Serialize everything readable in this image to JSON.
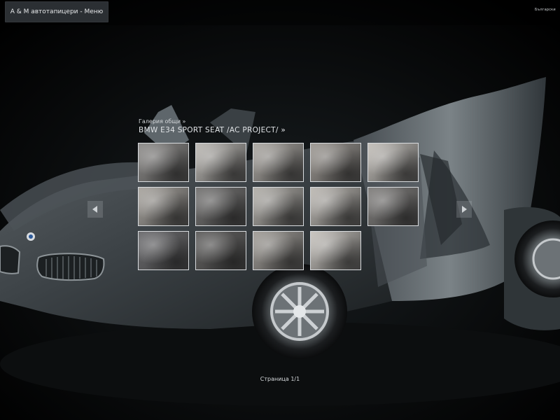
{
  "header": {
    "menu_label": "A & M автотапицери - Меню",
    "language_label": "Български"
  },
  "gallery": {
    "breadcrumb": "Галерия общи »",
    "title": "BMW E34 SPORT SEAT /AC PROJECT/ »",
    "rows": [
      [
        {
          "tone": "#8a8886"
        },
        {
          "tone": "#b9b6b1"
        },
        {
          "tone": "#a9a59f"
        },
        {
          "tone": "#9a958f"
        },
        {
          "tone": "#c2beb8"
        }
      ],
      [
        {
          "tone": "#a7a39d"
        },
        {
          "tone": "#6f6e6d"
        },
        {
          "tone": "#b1aea8"
        },
        {
          "tone": "#bcb8b2"
        },
        {
          "tone": "#7d7b79"
        }
      ],
      [
        {
          "tone": "#67676a"
        },
        {
          "tone": "#5b5a59"
        },
        {
          "tone": "#9f9b95"
        },
        {
          "tone": "#c6c2bc"
        }
      ]
    ]
  },
  "pagination": {
    "label": "Страница 1/1"
  },
  "colors": {
    "background": "#050607",
    "car_body": "#3f4549",
    "thumb_border": "#d9dcdf",
    "text": "#e0e3e6",
    "menu_button_bg": "#2b2f33"
  },
  "icons": {
    "prev": "chevron-left-icon",
    "next": "chevron-right-icon"
  }
}
